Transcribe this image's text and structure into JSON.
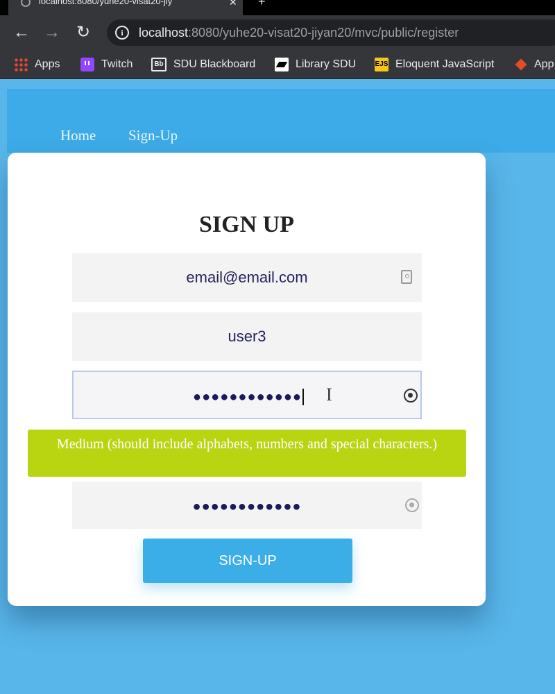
{
  "browser": {
    "tab_title": "localhost:8080/yuhe20-visat20-jiy",
    "url_host": "localhost",
    "url_rest": ":8080/yuhe20-visat20-jiyan20/mvc/public/register",
    "bookmarks": [
      {
        "label": "Apps",
        "icon": "apps-icon"
      },
      {
        "label": "Twitch",
        "icon": "twitch-icon"
      },
      {
        "label": "SDU Blackboard",
        "icon": "blackboard-icon"
      },
      {
        "label": "Library SDU",
        "icon": "library-icon"
      },
      {
        "label": "Eloquent JavaScript",
        "icon": "ejs-icon"
      },
      {
        "label": "App",
        "icon": "app-icon"
      }
    ]
  },
  "nav": {
    "home": "Home",
    "signup": "Sign-Up"
  },
  "form": {
    "title": "SIGN UP",
    "email_value": "email@email.com",
    "username_value": "user3",
    "password_mask": "●●●●●●●●●●●●",
    "confirm_mask": "●●●●●●●●●●●●",
    "strength_message": "Medium (should include alphabets, numbers and special characters.)",
    "submit_label": "SIGN-UP"
  },
  "colors": {
    "page_bg": "#59b6ea",
    "navbar_bg": "#3dabe7",
    "strength_bg": "#b9d511",
    "button_bg": "#3baee8"
  }
}
